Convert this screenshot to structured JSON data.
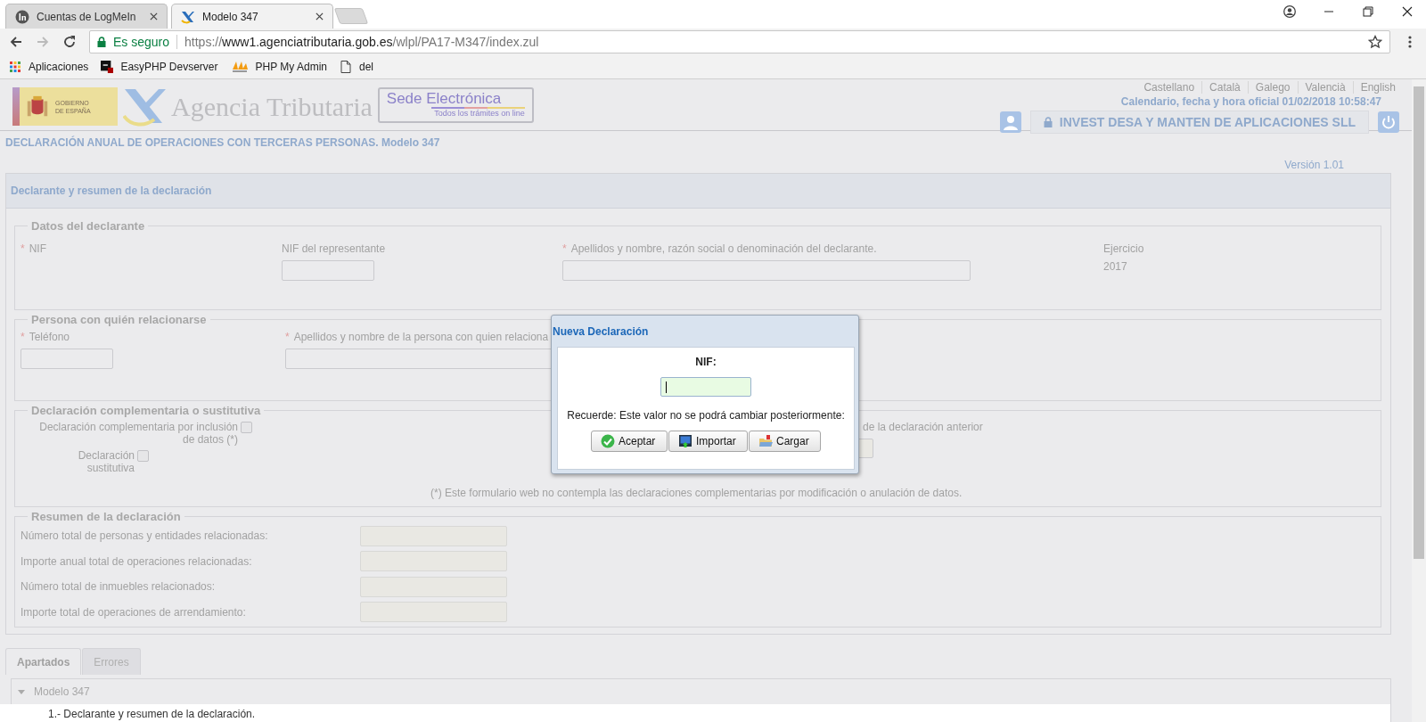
{
  "browser": {
    "tabs": [
      {
        "title": "Cuentas de LogMeIn",
        "kind": "logmein",
        "selected": false
      },
      {
        "title": "Modelo 347",
        "kind": "agency",
        "selected": true
      }
    ],
    "address": {
      "secure_label": "Es seguro",
      "scheme": "https://",
      "host": "www1.agenciatributaria.gob.es",
      "path": "/wlpl/PA17-M347/index.zul"
    },
    "bookmarks": [
      {
        "label": "Aplicaciones",
        "kind": "apps"
      },
      {
        "label": "EasyPHP Devserver",
        "kind": "easyphp"
      },
      {
        "label": "PHP My Admin",
        "kind": "pma"
      },
      {
        "label": "del",
        "kind": "page"
      }
    ]
  },
  "header": {
    "gov_logo": [
      "GOBIERNO",
      "DE ESPAÑA"
    ],
    "agency_name": "Agencia Tributaria",
    "sede_title": "Sede Electrónica",
    "sede_subtitle": "Todos los trámites on line",
    "languages": [
      "Castellano",
      "Català",
      "Galego",
      "Valencià",
      "English"
    ],
    "datetime": "Calendario, fecha y hora oficial 01/02/2018 10:58:47",
    "user": "INVEST DESA Y MANTEN DE APLICACIONES SLL"
  },
  "page_title": "DECLARACIÓN ANUAL DE OPERACIONES CON TERCERAS PERSONAS. Modelo 347",
  "version": "Versión 1.01",
  "panel_title": "Declarante y resumen de la declaración",
  "declarante": {
    "legend": "Datos del declarante",
    "fields": [
      {
        "label": "NIF",
        "required_mark": "*",
        "kind": "label"
      },
      {
        "label": "NIF del representante",
        "kind": "input"
      },
      {
        "label": "Apellidos y nombre, razón social o denominación del declarante.",
        "required_mark": "*",
        "kind": "input"
      },
      {
        "label": "Ejercicio",
        "kind": "text",
        "value": "2017"
      }
    ]
  },
  "contacto": {
    "legend": "Persona con quién relacionarse",
    "fields": [
      {
        "label": "Teléfono",
        "required_mark": "*",
        "kind": "input"
      },
      {
        "label": "Apellidos y nombre de la persona con quien relaciona",
        "required_mark": "*",
        "kind": "input"
      }
    ]
  },
  "complementaria": {
    "legend": "Declaración complementaria o sustitutiva",
    "checks": [
      {
        "label": "Declaración complementaria por inclusión de datos (*)",
        "checked": false
      },
      {
        "label": "Declaración sustitutiva",
        "checked": false
      }
    ],
    "previous_label": "de la declaración anterior",
    "footnote": "(*) Este formulario web no contempla las declaraciones complementarias por modificación o anulación de datos."
  },
  "resumen": {
    "legend": "Resumen de la declaración",
    "rows": [
      {
        "label": "Número total de personas y entidades relacionadas:",
        "disabled": true
      },
      {
        "label": "Importe anual total de operaciones relacionadas:",
        "disabled": true
      },
      {
        "label": "Número total de inmuebles relacionados:",
        "disabled": true
      },
      {
        "label": "Importe total de operaciones de arrendamiento:",
        "disabled": true
      }
    ]
  },
  "bottom_tabs": [
    {
      "label": "Apartados",
      "selected": true
    },
    {
      "label": "Errores",
      "selected": false
    }
  ],
  "tree": [
    {
      "label": "Modelo 347",
      "expanded": true,
      "children": [
        {
          "label": "1.- Declarante y resumen de la declaración."
        }
      ]
    }
  ],
  "modal": {
    "title": "Nueva Declaración",
    "field_label": "NIF:",
    "focused": true,
    "note": "Recuerde: Este valor no se podrá cambiar posteriormente:",
    "buttons": [
      {
        "label": "Aceptar",
        "kind": "accept"
      },
      {
        "label": "Importar",
        "kind": "import"
      },
      {
        "label": "Cargar",
        "kind": "load"
      }
    ]
  }
}
